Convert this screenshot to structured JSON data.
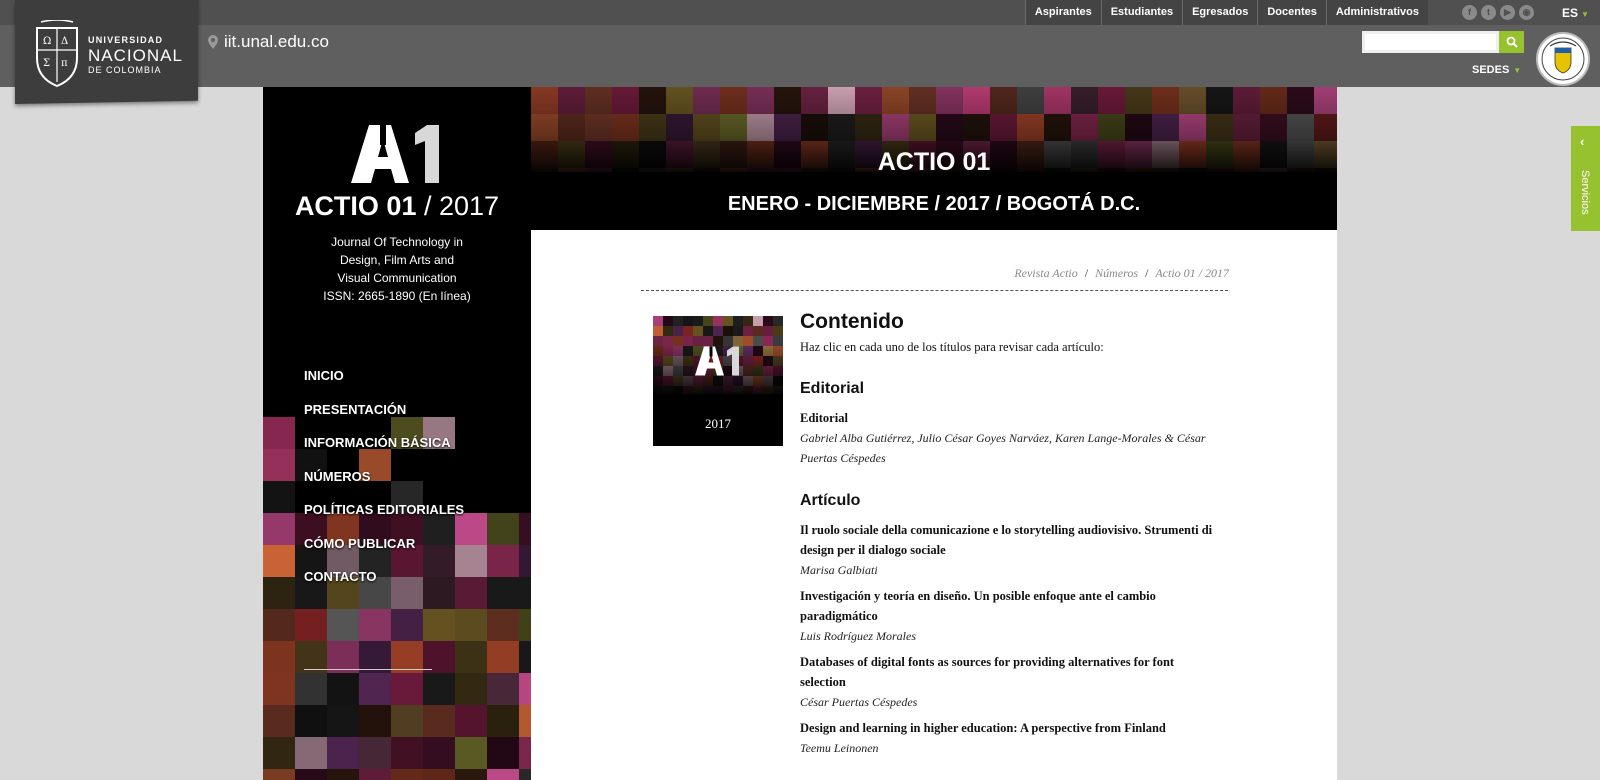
{
  "header": {
    "logo": {
      "line1": "UNIVERSIDAD",
      "line2": "NACIONAL",
      "line3": "DE COLOMBIA"
    },
    "site_url": "iit.unal.edu.co",
    "tabs": [
      "Aspirantes",
      "Estudiantes",
      "Egresados",
      "Docentes",
      "Administrativos"
    ],
    "social_icons": [
      "facebook-icon",
      "twitter-icon",
      "youtube-icon",
      "rss-icon"
    ],
    "language": "ES",
    "search_placeholder": "",
    "sedes_label": "SEDES"
  },
  "sidebar_tab": {
    "label": "Servicios"
  },
  "journal": {
    "title_bold": "ACTIO 01",
    "title_rest": " / 2017",
    "subtitle_lines": [
      "Journal Of Technology in",
      "Design, Film Arts and",
      "Visual Communication",
      "ISSN: 2665-1890 (En línea)"
    ],
    "nav": [
      "INICIO",
      "PRESENTACIÓN",
      "INFORMACIÓN BÁSICA",
      "NÚMEROS",
      "POLÍTICAS EDITORIALES",
      "CÓMO PUBLICAR",
      "CONTACTO"
    ]
  },
  "banner": {
    "title": "ACTIO 01",
    "subtitle": "ENERO - DICIEMBRE / 2017 / BOGOTÁ D.C."
  },
  "breadcrumb": [
    "Revista Actio",
    "Números",
    "Actio 01 / 2017"
  ],
  "cover": {
    "year": "2017"
  },
  "toc": {
    "heading": "Contenido",
    "intro": "Haz clic en cada uno de los títulos para revisar cada artículo:",
    "sections": [
      {
        "name": "Editorial",
        "items": [
          {
            "title": "Editorial",
            "authors": "Gabriel Alba Gutiérrez, Julio César Goyes Narváez, Karen Lange-Morales & César Puertas Céspedes"
          }
        ]
      },
      {
        "name": "Artículo",
        "items": [
          {
            "title": "Il ruolo sociale della comunicazione e lo storytelling audiovisivo. Strumenti di design per il dialogo sociale",
            "authors": "Marisa Galbiati"
          },
          {
            "title": "Investigación y teoría en diseño. Un posible enfoque ante el cambio paradigmático",
            "authors": "Luis Rodríguez Morales"
          },
          {
            "title": "Databases of digital fonts as sources for providing alternatives for font selection",
            "authors": "César Puertas Céspedes"
          },
          {
            "title": "Design and learning in higher education: A perspective from Finland",
            "authors": "Teemu Leinonen"
          }
        ]
      }
    ]
  },
  "colors": {
    "accent_green": "#96c230",
    "topbar": "#5f5f5f",
    "journal_black": "#000000"
  }
}
